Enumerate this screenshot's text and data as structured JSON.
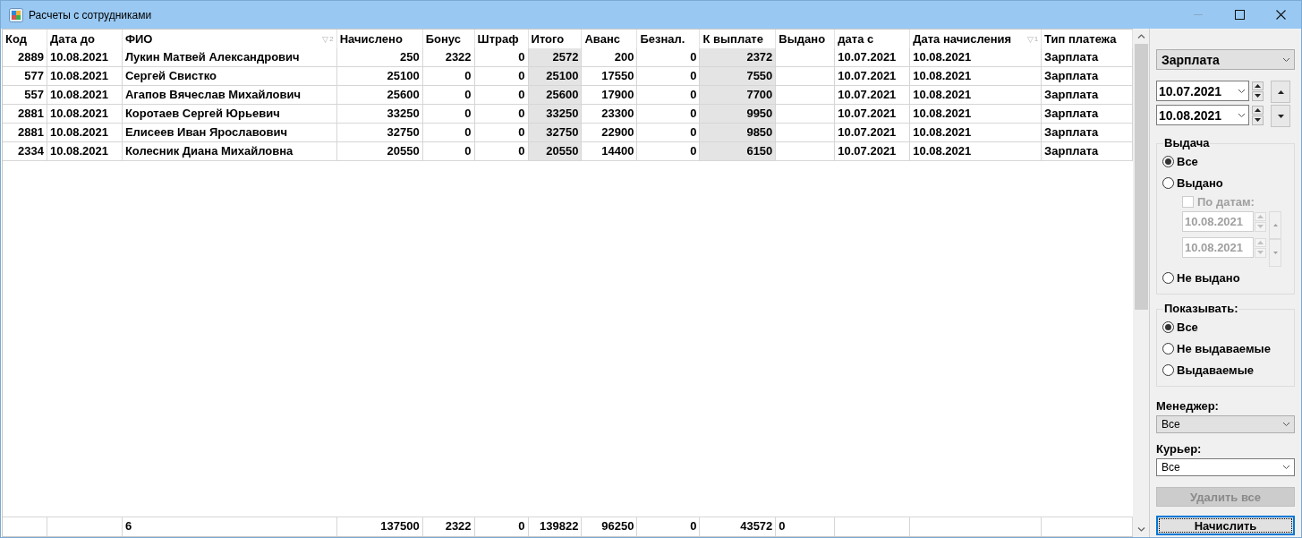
{
  "window": {
    "title": "Расчеты с сотрудниками"
  },
  "table": {
    "columns": [
      {
        "label": "Код",
        "shaded": false
      },
      {
        "label": "Дата до",
        "shaded": false
      },
      {
        "label": "ФИО",
        "shaded": false,
        "sort_mark": "▽",
        "sort_order": "2"
      },
      {
        "label": "Начислено",
        "shaded": false
      },
      {
        "label": "Бонус",
        "shaded": false
      },
      {
        "label": "Штраф",
        "shaded": false
      },
      {
        "label": "Итого",
        "shaded": true
      },
      {
        "label": "Аванс",
        "shaded": false
      },
      {
        "label": "Безнал.",
        "shaded": false
      },
      {
        "label": "К выплате",
        "shaded": true
      },
      {
        "label": "Выдано",
        "shaded": false
      },
      {
        "label": "дата с",
        "shaded": false
      },
      {
        "label": "Дата начисления",
        "shaded": false,
        "sort_mark": "▽",
        "sort_order": "1"
      },
      {
        "label": "Тип платежа",
        "shaded": false
      }
    ],
    "rows": [
      [
        "2889",
        "10.08.2021",
        "Лукин Матвей Александрович",
        "250",
        "2322",
        "0",
        "2572",
        "200",
        "0",
        "2372",
        "",
        "10.07.2021",
        "10.08.2021",
        "Зарплата"
      ],
      [
        "577",
        "10.08.2021",
        "Сергей Свистко",
        "25100",
        "0",
        "0",
        "25100",
        "17550",
        "0",
        "7550",
        "",
        "10.07.2021",
        "10.08.2021",
        "Зарплата"
      ],
      [
        "557",
        "10.08.2021",
        "Агапов Вячеслав Михайлович",
        "25600",
        "0",
        "0",
        "25600",
        "17900",
        "0",
        "7700",
        "",
        "10.07.2021",
        "10.08.2021",
        "Зарплата"
      ],
      [
        "2881",
        "10.08.2021",
        "Коротаев Сергей Юрьевич",
        "33250",
        "0",
        "0",
        "33250",
        "23300",
        "0",
        "9950",
        "",
        "10.07.2021",
        "10.08.2021",
        "Зарплата"
      ],
      [
        "2881",
        "10.08.2021",
        "Елисеев Иван Ярославович",
        "32750",
        "0",
        "0",
        "32750",
        "22900",
        "0",
        "9850",
        "",
        "10.07.2021",
        "10.08.2021",
        "Зарплата"
      ],
      [
        "2334",
        "10.08.2021",
        "Колесник Диана Михайловна",
        "20550",
        "0",
        "0",
        "20550",
        "14400",
        "0",
        "6150",
        "",
        "10.07.2021",
        "10.08.2021",
        "Зарплата"
      ]
    ],
    "footer": {
      "column_3": "6",
      "column_4": "137500",
      "column_5": "2322",
      "column_6": "0",
      "column_7": "139822",
      "column_8": "96250",
      "column_9": "0",
      "column_10": "43572",
      "column_11": "0"
    }
  },
  "panel": {
    "payment_type": {
      "value": "Зарплата"
    },
    "date_from": {
      "value": "10.07.2021"
    },
    "date_to": {
      "value": "10.08.2021"
    },
    "issue": {
      "title": "Выдача",
      "options": [
        {
          "kind": "radio",
          "label": "Все",
          "selected": true
        },
        {
          "kind": "radio",
          "label": "Выдано",
          "selected": false
        },
        {
          "kind": "date-filter",
          "label": "По датам:",
          "checked": false,
          "disabled": true,
          "dates": [
            "10.08.2021",
            "10.08.2021"
          ]
        },
        {
          "kind": "radio",
          "label": "Не выдано",
          "selected": false
        }
      ]
    },
    "show": {
      "title": "Показывать:",
      "options": [
        {
          "kind": "radio",
          "label": "Все",
          "selected": true
        },
        {
          "kind": "radio",
          "label": "Не выдаваемые",
          "selected": false
        },
        {
          "kind": "radio",
          "label": "Выдаваемые",
          "selected": false
        }
      ]
    },
    "manager": {
      "label": "Менеджер:",
      "value": "Все",
      "editable": false
    },
    "courier": {
      "label": "Курьер:",
      "value": "Все",
      "editable": true
    },
    "buttons": [
      {
        "label": "Удалить все",
        "disabled": true,
        "focused": false
      },
      {
        "label": "Начислить",
        "disabled": false,
        "focused": true
      }
    ]
  }
}
